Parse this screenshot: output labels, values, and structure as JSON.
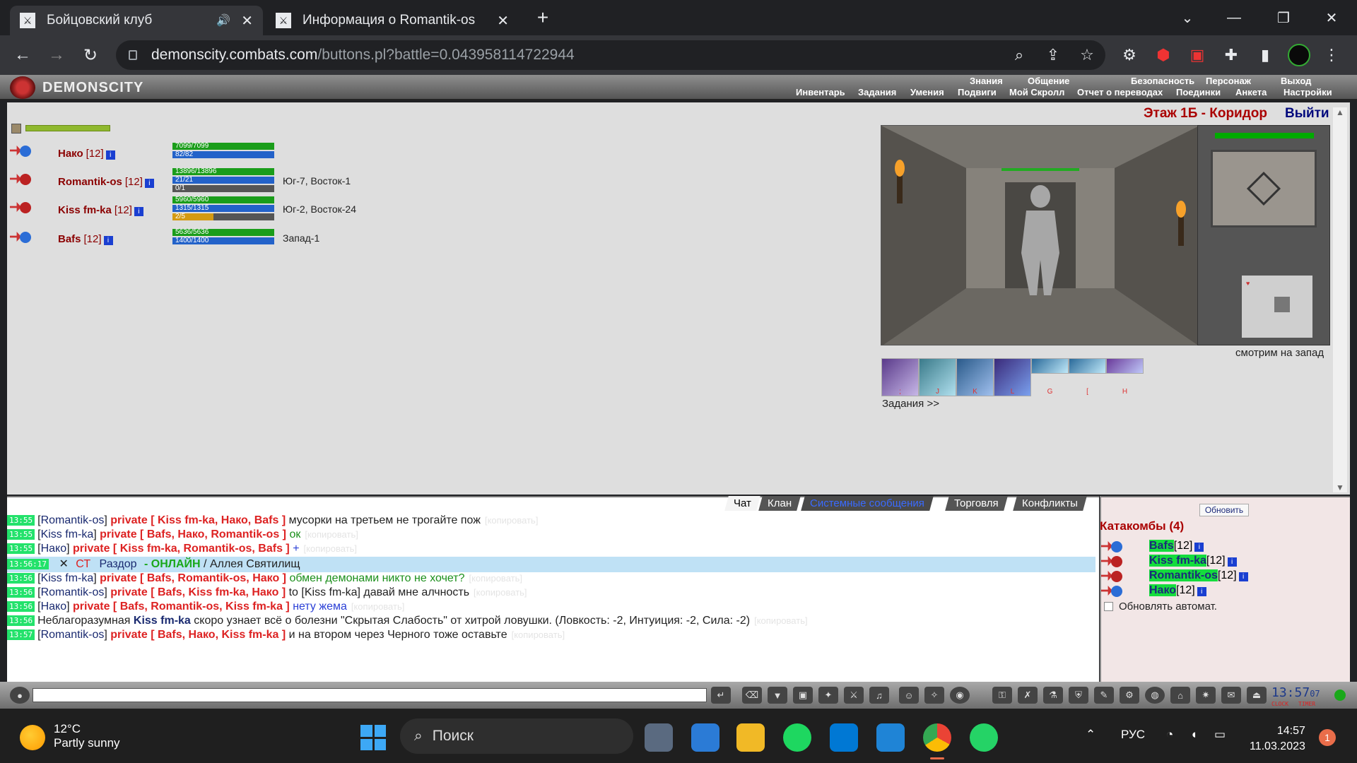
{
  "browser": {
    "tabs": [
      {
        "title": "Бойцовский клуб",
        "favicon": "⚔",
        "active": true
      },
      {
        "title": "Информация о Romantik-os",
        "favicon": "⚔",
        "active": false
      }
    ],
    "url_host": "demonscity.combats.com",
    "url_path": "/buttons.pl?battle=0.043958114722944"
  },
  "game": {
    "logo": "DEMONSCITY",
    "menu_top": [
      "Знания",
      "Общение",
      "Безопасность",
      "Персонаж",
      "Выход"
    ],
    "menu_bottom": [
      "Инвентарь",
      "Задания",
      "Умения",
      "Подвиги",
      "Мой Скролл",
      "Отчет о переводах",
      "Поединки",
      "Анкета",
      "Настройки"
    ],
    "location": "Этаж 1Б - Коридор",
    "exit_label": "Выйти",
    "looking": "смотрим на запад",
    "tasks_label": "Задания >>",
    "slot_keys": [
      ";",
      "J",
      "K",
      "L",
      "G",
      "[",
      "H"
    ],
    "players": [
      {
        "name": "Нако",
        "level": "[12]",
        "hp": "7099/7099",
        "mp": "82/82",
        "pos": "",
        "extra": []
      },
      {
        "name": "Romantik-os",
        "level": "[12]",
        "hp": "13896/13896",
        "mp": "21/21",
        "pos": "Юг-7, Восток-1",
        "extra": [
          "0/1"
        ]
      },
      {
        "name": "Kiss fm-ka",
        "level": "[12]",
        "hp": "5960/5960",
        "mp": "1315/1315",
        "pos": "Юг-2, Восток-24",
        "extra": [
          "2/5"
        ]
      },
      {
        "name": "Bafs",
        "level": "[12]",
        "hp": "5636/5636",
        "mp": "1400/1400",
        "pos": "Запад-1",
        "extra": []
      }
    ]
  },
  "chat": {
    "tabs": [
      "Чат",
      "Клан",
      "Системные сообщения",
      "Торговля",
      "Конфликты"
    ],
    "copy": "[копировать]",
    "messages": [
      {
        "time": "13:55",
        "nick": "Romantik-os",
        "to": "private [ Kiss fm-ka, Нако, Bafs ]",
        "text": "мусорки на третьем не трогайте пож",
        "color": "#222"
      },
      {
        "time": "13:55",
        "nick": "Kiss fm-ka",
        "to": "private [ Bafs, Нако, Romantik-os ]",
        "text": "ок",
        "color": "#1a8f1a"
      },
      {
        "time": "13:55",
        "nick": "Нако",
        "to": "private [ Kiss fm-ka, Romantik-os, Bafs ]",
        "text": "+",
        "color": "#2a3fd6"
      },
      {
        "time": "13:56",
        "nick": "Kiss fm-ka",
        "to": "private [ Bafs, Romantik-os, Нако ]",
        "text": "обмен демонами никто не хочет?",
        "color": "#1a8f1a"
      },
      {
        "time": "13:56",
        "nick": "Romantik-os",
        "to": "private [ Bafs, Kiss fm-ka, Нако ]",
        "text": "to [Kiss fm-ka] давай мне алчность",
        "color": "#222"
      },
      {
        "time": "13:56",
        "nick": "Нако",
        "to": "private [ Bafs, Romantik-os, Kiss fm-ka ]",
        "text": "нету жема",
        "color": "#2a3fd6"
      }
    ],
    "highlight": {
      "time": "13:56:17",
      "tag": "СТ",
      "name": "Раздор",
      "status": "- ОНЛАЙН",
      "place": "/ Аллея Святилищ"
    },
    "system": {
      "time": "13:56",
      "pre": "Неблагоразумная",
      "who": "Kiss fm-ka",
      "text": "скоро узнает всё о болезни \"Скрытая Слабость\" от хитрой ловушки. (Ловкость: -2, Интуиция: -2, Сила: -2)"
    },
    "last": {
      "time": "13:57",
      "nick": "Romantik-os",
      "to": "private [ Bafs, Нако, Kiss fm-ka ]",
      "text": "и на втором через Черного тоже оставьте"
    }
  },
  "right_panel": {
    "refresh_label": "Обновить",
    "title": "Катакомбы (4)",
    "players": [
      {
        "name": "Bafs",
        "level": "[12]"
      },
      {
        "name": "Kiss fm-ka",
        "level": "[12]"
      },
      {
        "name": "Romantik-os",
        "level": "[12]"
      },
      {
        "name": "Нако",
        "level": "[12]"
      }
    ],
    "auto_label": "Обновлять автомат."
  },
  "clock": {
    "time": "13:57",
    "sec": "07",
    "label1": "CLOCK",
    "label2": "TIMER"
  },
  "taskbar": {
    "temp": "12°C",
    "weather": "Partly sunny",
    "search": "Поиск",
    "lang": "РУС",
    "time": "14:57",
    "date": "11.03.2023",
    "badge": "1"
  }
}
